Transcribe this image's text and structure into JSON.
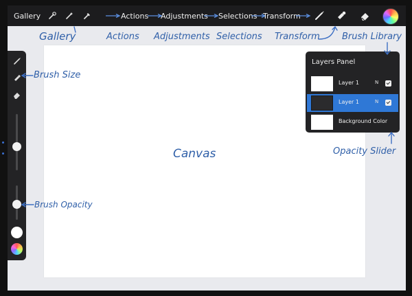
{
  "topbar": {
    "gallery_label": "Gallery",
    "tools": [
      "wrench-icon",
      "magic-wand-icon",
      "pen-nib-icon"
    ],
    "menu": [
      "Actions",
      "Adjustments",
      "Selections",
      "Transform"
    ],
    "right_tools": [
      "brush-icon",
      "smudge-icon",
      "eraser-icon",
      "color-wheel-icon"
    ]
  },
  "sidebar": {
    "brush_size_level": 0.42,
    "brush_opacity_level": 0.45
  },
  "layers_panel": {
    "title": "Layers Panel",
    "layers": [
      {
        "name": "Layer 1",
        "mode": "N",
        "visible": true,
        "active": false
      },
      {
        "name": "Layer 1",
        "mode": "N",
        "visible": true,
        "active": true
      },
      {
        "name": "Background Color",
        "visible": true,
        "active": false
      }
    ]
  },
  "annotations": {
    "gallery": "Gallery",
    "actions": "Actions",
    "adjustments": "Adjustments",
    "selections": "Selections",
    "transform": "Transform",
    "brush_library": "Brush Library",
    "brush_size": "Brush Size",
    "brush_opacity": "Brush Opacity",
    "canvas": "Canvas",
    "opacity_slider": "Opacity Slider"
  },
  "colors": {
    "accent": "#2f78d6",
    "annotation": "#2f5fa8",
    "toolbar": "#1c1c1e"
  }
}
